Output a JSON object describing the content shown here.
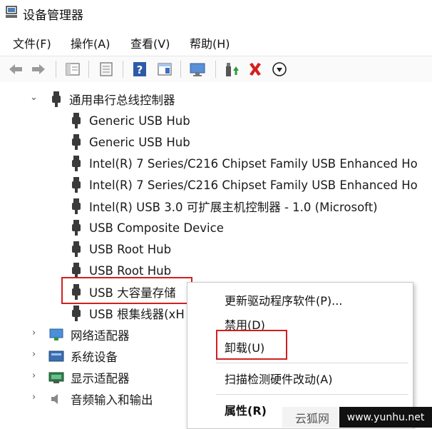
{
  "window": {
    "title": "设备管理器"
  },
  "menubar": {
    "items": [
      "文件(F)",
      "操作(A)",
      "查看(V)",
      "帮助(H)"
    ]
  },
  "toolbar": {
    "icons": [
      "back-arrow-icon",
      "forward-arrow-icon",
      "show-hide-tree-icon",
      "properties-icon",
      "help-icon",
      "view-icon",
      "monitor-scan-icon",
      "update-driver-icon",
      "uninstall-x-icon",
      "download-circle-icon"
    ]
  },
  "tree": {
    "category": "通用串行总线控制器",
    "devices": [
      "Generic USB Hub",
      "Generic USB Hub",
      "Intel(R) 7 Series/C216 Chipset Family USB Enhanced Ho",
      "Intel(R) 7 Series/C216 Chipset Family USB Enhanced Ho",
      "Intel(R) USB 3.0 可扩展主机控制器 - 1.0 (Microsoft)",
      "USB Composite Device",
      "USB Root Hub",
      "USB Root Hub",
      "USB 大容量存储",
      "USB 根集线器(xH"
    ],
    "other_categories": [
      "网络适配器",
      "系统设备",
      "显示适配器",
      "音频输入和输出"
    ]
  },
  "context_menu": {
    "update_driver": "更新驱动程序软件(P)...",
    "disable": "禁用(D)",
    "uninstall": "卸载(U)",
    "scan": "扫描检测硬件改动(A)",
    "properties": "属性(R)"
  },
  "watermark": {
    "left": "云狐网",
    "right": "www.yunhu.net"
  },
  "colors": {
    "highlight_red": "#d21f1f",
    "usb_icon": "#3a3a3a"
  }
}
